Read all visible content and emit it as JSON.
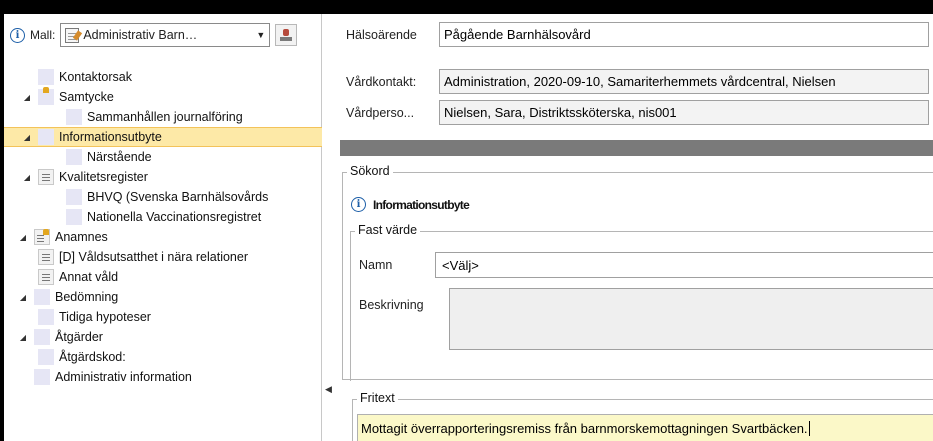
{
  "mall": {
    "label": "Mall:",
    "value": "Administrativ Barn…"
  },
  "tree": [
    {
      "label": "Kontaktorsak",
      "icon": "plain"
    },
    {
      "label": "Samtycke",
      "icon": "lock",
      "expander": "◢"
    },
    {
      "label": "Sammanhållen journalföring",
      "icon": "plain"
    },
    {
      "label": "Informationsutbyte",
      "icon": "plain",
      "expander": "◢",
      "selected": true
    },
    {
      "label": "Närstående",
      "icon": "plain"
    },
    {
      "label": "Kvalitetsregister",
      "icon": "list",
      "expander": "◢"
    },
    {
      "label": "BHVQ (Svenska Barnhälsovårds",
      "icon": "plain"
    },
    {
      "label": "Nationella Vaccinationsregistret",
      "icon": "plain"
    },
    {
      "label": "Anamnes",
      "icon": "lock-list",
      "expander": "◢"
    },
    {
      "label": "[D] Våldsutsatthet i nära relationer",
      "icon": "list"
    },
    {
      "label": "Annat våld",
      "icon": "list"
    },
    {
      "label": "Bedömning",
      "icon": "plain",
      "expander": "◢"
    },
    {
      "label": "Tidiga hypoteser",
      "icon": "plain"
    },
    {
      "label": "Åtgärder",
      "icon": "plain",
      "expander": "◢"
    },
    {
      "label": "Åtgärdskod:",
      "icon": "plain"
    },
    {
      "label": "Administrativ information",
      "icon": "plain"
    }
  ],
  "header": {
    "halsoarende_label": "Hälsoärende",
    "halsoarende_value": "Pågående Barnhälsovård",
    "vardkontakt_label": "Vårdkontakt:",
    "vardkontakt_value": "Administration, 2020-09-10, Samariterhemmets vårdcentral, Nielsen",
    "vardperson_label": "Vårdperso...",
    "vardperson_value": "Nielsen, Sara, Distriktssköterska, nis001"
  },
  "sokord": {
    "legend": "Sökord",
    "title": "Informationsutbyte",
    "fast_varde": {
      "legend": "Fast värde",
      "namn_label": "Namn",
      "namn_value": "<Välj>",
      "beskrivning_label": "Beskrivning"
    }
  },
  "fritext": {
    "legend": "Fritext",
    "value": "Mottagit överrapporteringsremiss från barnmorskemottagningen Svartbäcken."
  },
  "colors": {
    "selected_bg": "#fde9a7",
    "info_blue": "#1d5fa8",
    "fritext_bg": "#fbf8c8",
    "band_grey": "#7a7a7a"
  }
}
